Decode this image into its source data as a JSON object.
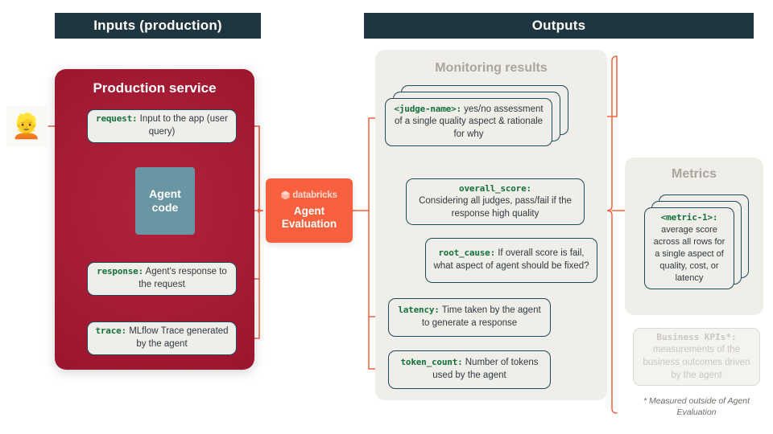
{
  "headers": {
    "inputs": "Inputs (production)",
    "outputs": "Outputs"
  },
  "production_service": {
    "title": "Production service",
    "user_icon": "person-emoji",
    "agent_code": "Agent\ncode",
    "agent_code_line1": "Agent",
    "agent_code_line2": "code",
    "fields": [
      {
        "key": "request:",
        "desc": "Input to the app (user query)"
      },
      {
        "key": "response:",
        "desc": "Agent's response to the request"
      },
      {
        "key": "trace:",
        "desc": "MLflow Trace generated by the agent"
      }
    ]
  },
  "agent_evaluation": {
    "logo_text": "databricks",
    "logo_icon": "databricks-logo-icon",
    "title_line1": "Agent",
    "title_line2": "Evaluation"
  },
  "monitoring_results": {
    "title": "Monitoring results",
    "judge": {
      "key": "<judge-name>:",
      "desc": "yes/no assessment of a single quality aspect & rationale for why"
    },
    "overall_score": {
      "key": "overall_score:",
      "desc": "Considering all judges, pass/fail if the response high quality"
    },
    "root_cause": {
      "key": "root_cause:",
      "desc": "If overall score is fail, what aspect of agent should be fixed?"
    },
    "latency": {
      "key": "latency:",
      "desc": "Time taken by the agent to generate a response"
    },
    "token_count": {
      "key": "token_count:",
      "desc": "Number of tokens used by the agent"
    }
  },
  "metrics": {
    "title": "Metrics",
    "metric": {
      "key": "<metric-1>:",
      "desc": "average score across all rows for a single aspect of quality, cost, or latency"
    },
    "business_kpi": {
      "key": "Business KPIs*:",
      "desc": "measurements of the business outcomes driven by the agent"
    },
    "footnote": "* Measured outside of Agent Evaluation"
  },
  "colors": {
    "header_bar": "#1F3540",
    "production_red": "#A31B33",
    "agent_eval_orange": "#F9603E",
    "agent_code_teal": "#6A95A3",
    "box_border": "#1F4A5A",
    "key_green": "#14713B",
    "panel_grey": "#EFEEE9",
    "connector_orange": "#F4603C",
    "muted_grey": "#C9C7C1"
  }
}
